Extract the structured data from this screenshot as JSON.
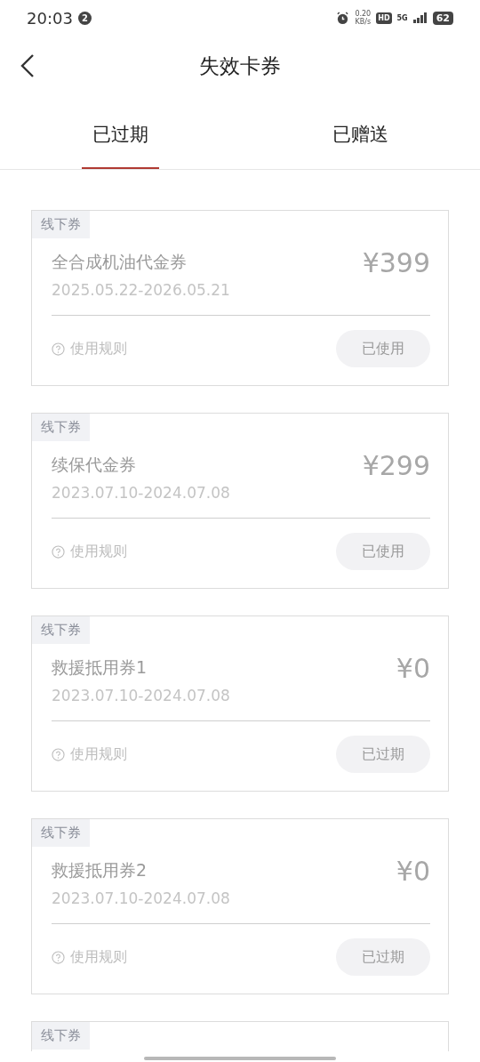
{
  "status_bar": {
    "time": "20:03",
    "notification_count": "2",
    "net_speed": "0.20",
    "net_unit": "KB/s",
    "hd": "HD",
    "network": "5G",
    "battery": "62"
  },
  "header": {
    "title": "失效卡券"
  },
  "tabs": [
    {
      "label": "已过期",
      "selected": true
    },
    {
      "label": "已赠送",
      "selected": false
    }
  ],
  "coupons": [
    {
      "tag": "线下券",
      "name": "全合成机油代金券",
      "price": "¥399",
      "validity": "2025.05.22-2026.05.21",
      "rules": "使用规则",
      "status": "已使用"
    },
    {
      "tag": "线下券",
      "name": "续保代金券",
      "price": "¥299",
      "validity": "2023.07.10-2024.07.08",
      "rules": "使用规则",
      "status": "已使用"
    },
    {
      "tag": "线下券",
      "name": "救援抵用券1",
      "price": "¥0",
      "validity": "2023.07.10-2024.07.08",
      "rules": "使用规则",
      "status": "已过期"
    },
    {
      "tag": "线下券",
      "name": "救援抵用券2",
      "price": "¥0",
      "validity": "2023.07.10-2024.07.08",
      "rules": "使用规则",
      "status": "已过期"
    },
    {
      "tag": "线下券"
    }
  ]
}
